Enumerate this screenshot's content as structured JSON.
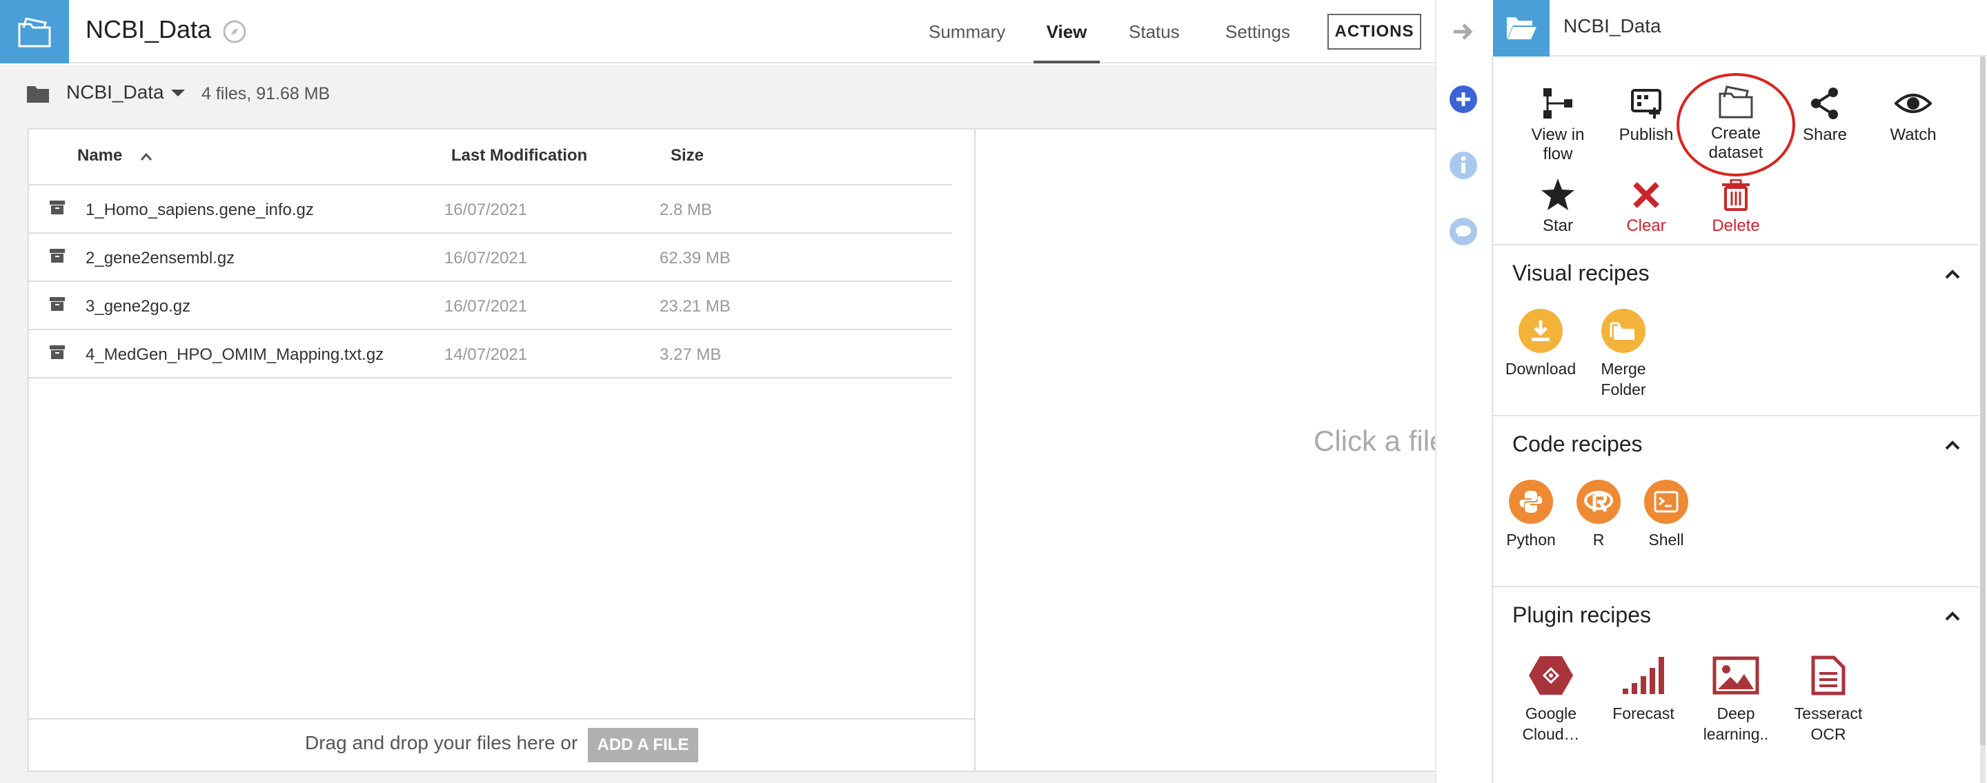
{
  "header": {
    "title": "NCBI_Data",
    "tabs": [
      {
        "label": "Summary"
      },
      {
        "label": "View"
      },
      {
        "label": "Status"
      },
      {
        "label": "Settings"
      }
    ],
    "active_tab": "View",
    "actions_label": "ACTIONS"
  },
  "breadcrumb": {
    "folder_name": "NCBI_Data",
    "summary": "4 files, 91.68 MB"
  },
  "file_table": {
    "columns": {
      "name": "Name",
      "modified": "Last Modification",
      "size": "Size"
    },
    "sort": "Name ascending",
    "rows": [
      {
        "name": "1_Homo_sapiens.gene_info.gz",
        "modified": "16/07/2021",
        "size": "2.8 MB"
      },
      {
        "name": "2_gene2ensembl.gz",
        "modified": "16/07/2021",
        "size": "62.39 MB"
      },
      {
        "name": "3_gene2go.gz",
        "modified": "16/07/2021",
        "size": "23.21 MB"
      },
      {
        "name": "4_MedGen_HPO_OMIM_Mapping.txt.gz",
        "modified": "14/07/2021",
        "size": "3.27 MB"
      }
    ],
    "drop_text": "Drag and drop your files here or",
    "add_file_label": "ADD A FILE"
  },
  "preview": {
    "hint": "Click a file"
  },
  "right_panel": {
    "title": "NCBI_Data",
    "actions": [
      {
        "label_line1": "View in",
        "label_line2": "flow"
      },
      {
        "label_line1": "Publish",
        "label_line2": ""
      },
      {
        "label_line1": "Create",
        "label_line2": "dataset"
      },
      {
        "label_line1": "Share",
        "label_line2": ""
      },
      {
        "label_line1": "Watch",
        "label_line2": ""
      },
      {
        "label_line1": "Star",
        "label_line2": ""
      },
      {
        "label_line1": "Clear",
        "label_line2": ""
      },
      {
        "label_line1": "Delete",
        "label_line2": ""
      }
    ],
    "visual_recipes": {
      "title": "Visual recipes",
      "items": [
        {
          "line1": "Download",
          "line2": ""
        },
        {
          "line1": "Merge",
          "line2": "Folder"
        }
      ]
    },
    "code_recipes": {
      "title": "Code recipes",
      "items": [
        {
          "line1": "Python"
        },
        {
          "line1": "R"
        },
        {
          "line1": "Shell"
        }
      ]
    },
    "plugin_recipes": {
      "title": "Plugin recipes",
      "items": [
        {
          "line1": "Google",
          "line2": "Cloud…"
        },
        {
          "line1": "Forecast",
          "line2": ""
        },
        {
          "line1": "Deep",
          "line2": "learning.."
        },
        {
          "line1": "Tesseract",
          "line2": "OCR"
        }
      ]
    }
  },
  "colors": {
    "brand_blue": "#4a9fd9",
    "danger_red": "#c8262c",
    "recipe_yellow": "#f3b23a",
    "recipe_orange": "#ee8a34",
    "plugin_red": "#a8343b",
    "highlight": "#d9231d"
  }
}
